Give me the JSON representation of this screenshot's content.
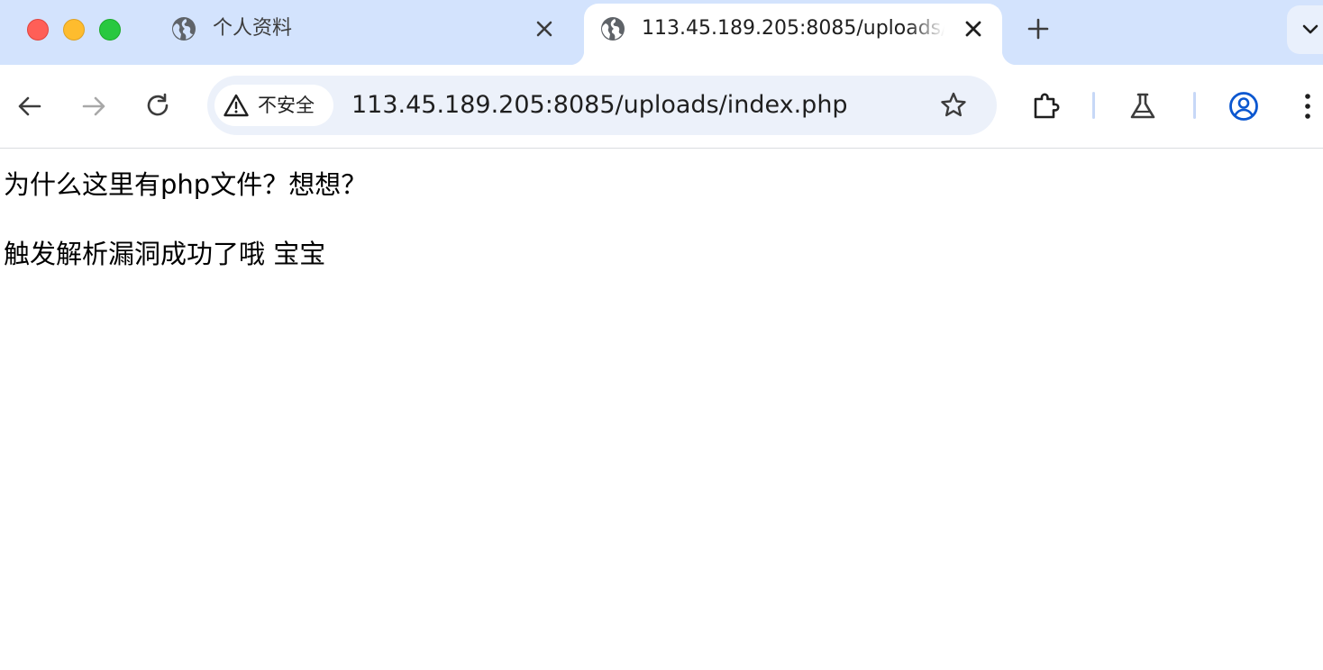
{
  "window": {
    "controls": [
      "close",
      "minimize",
      "zoom"
    ]
  },
  "tabs": [
    {
      "title": "个人资料",
      "favicon": "globe-icon",
      "active": false
    },
    {
      "title": "113.45.189.205:8085/uploads/index.php",
      "favicon": "globe-icon",
      "active": true
    }
  ],
  "toolbar": {
    "back_icon": "arrow-left-icon",
    "forward_icon": "arrow-right-icon",
    "reload_icon": "reload-icon",
    "security_label": "不安全",
    "url": "113.45.189.205:8085/uploads/index.php",
    "bookmark_icon": "star-icon",
    "extensions_icon": "puzzle-icon",
    "labs_icon": "flask-icon",
    "profile_icon": "account-circle-icon",
    "menu_icon": "kebab-menu-icon"
  },
  "colors": {
    "tabstrip_bg": "#d3e3fd",
    "omnibox_bg": "#ecf1fa",
    "profile_accent": "#0b57d0"
  },
  "page": {
    "lines": [
      "为什么这里有php文件？想想？",
      "触发解析漏洞成功了哦 宝宝"
    ]
  }
}
